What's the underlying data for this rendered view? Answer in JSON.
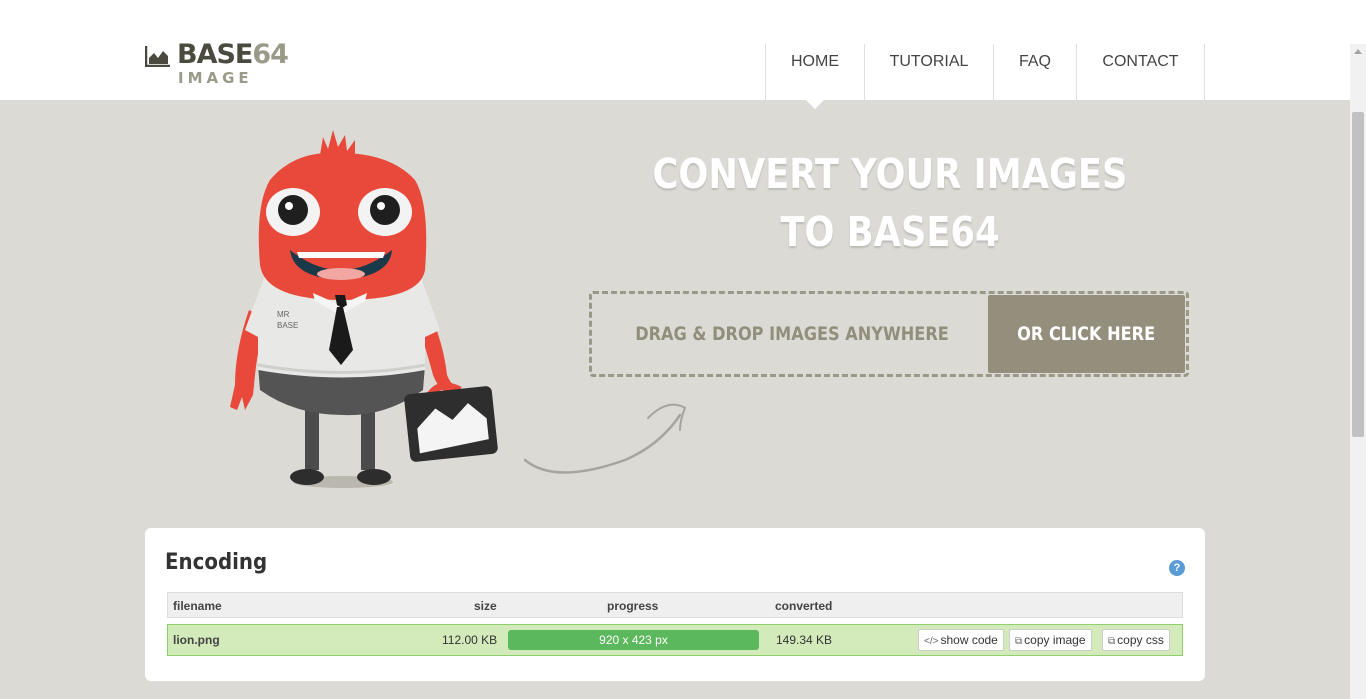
{
  "brand": {
    "name_main": "BASE",
    "name_num": "64",
    "name_sub": "IMAGE"
  },
  "nav": {
    "items": [
      "HOME",
      "TUTORIAL",
      "FAQ",
      "CONTACT"
    ],
    "active": "HOME"
  },
  "mascot": {
    "shirt_text_line1": "MR",
    "shirt_text_line2": "BASE"
  },
  "hero": {
    "headline_line1": "CONVERT YOUR IMAGES",
    "headline_line2": "TO BASE64",
    "drop_text": "DRAG & DROP IMAGES ANYWHERE",
    "click_button": "OR CLICK HERE"
  },
  "encoding": {
    "title": "Encoding",
    "help_icon": "?",
    "columns": {
      "filename": "filename",
      "size": "size",
      "progress": "progress",
      "converted": "converted"
    },
    "rows": [
      {
        "filename": "lion.png",
        "size": "112.00 KB",
        "progress_label": "920 x 423 px",
        "progress": 1.0,
        "converted": "149.34 KB",
        "actions": [
          "show code",
          "copy image",
          "copy css"
        ]
      }
    ]
  },
  "colors": {
    "hero_bg": "#dcdad4",
    "accent_button": "#948f7c",
    "mascot_red": "#e8493a",
    "progress_green": "#5cb85c",
    "row_bg": "#d3eaba",
    "help_blue": "#5b9bd5"
  },
  "icons": [
    "chart-logo-icon",
    "help-icon",
    "code-icon",
    "copy-icon"
  ]
}
